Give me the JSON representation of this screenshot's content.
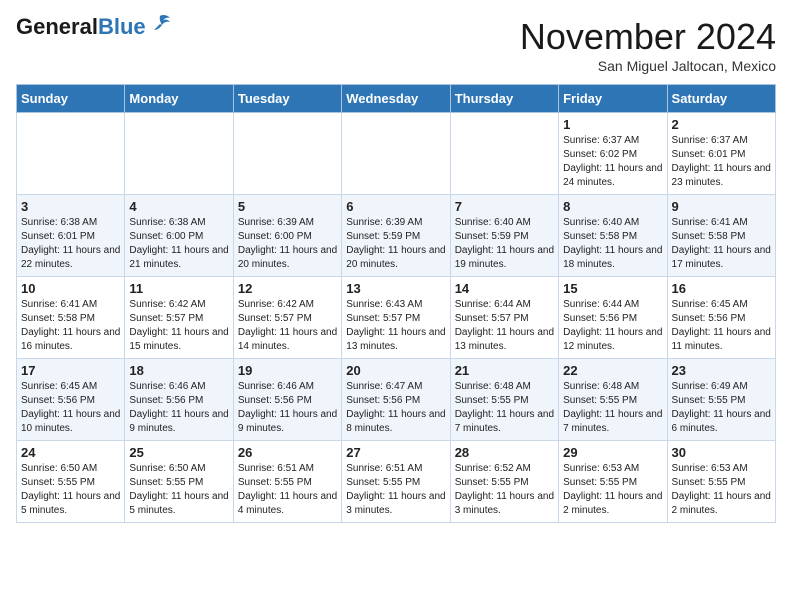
{
  "header": {
    "logo_general": "General",
    "logo_blue": "Blue",
    "month_title": "November 2024",
    "location": "San Miguel Jaltocan, Mexico"
  },
  "weekdays": [
    "Sunday",
    "Monday",
    "Tuesday",
    "Wednesday",
    "Thursday",
    "Friday",
    "Saturday"
  ],
  "weeks": [
    [
      {
        "day": "",
        "info": ""
      },
      {
        "day": "",
        "info": ""
      },
      {
        "day": "",
        "info": ""
      },
      {
        "day": "",
        "info": ""
      },
      {
        "day": "",
        "info": ""
      },
      {
        "day": "1",
        "info": "Sunrise: 6:37 AM\nSunset: 6:02 PM\nDaylight: 11 hours and 24 minutes."
      },
      {
        "day": "2",
        "info": "Sunrise: 6:37 AM\nSunset: 6:01 PM\nDaylight: 11 hours and 23 minutes."
      }
    ],
    [
      {
        "day": "3",
        "info": "Sunrise: 6:38 AM\nSunset: 6:01 PM\nDaylight: 11 hours and 22 minutes."
      },
      {
        "day": "4",
        "info": "Sunrise: 6:38 AM\nSunset: 6:00 PM\nDaylight: 11 hours and 21 minutes."
      },
      {
        "day": "5",
        "info": "Sunrise: 6:39 AM\nSunset: 6:00 PM\nDaylight: 11 hours and 20 minutes."
      },
      {
        "day": "6",
        "info": "Sunrise: 6:39 AM\nSunset: 5:59 PM\nDaylight: 11 hours and 20 minutes."
      },
      {
        "day": "7",
        "info": "Sunrise: 6:40 AM\nSunset: 5:59 PM\nDaylight: 11 hours and 19 minutes."
      },
      {
        "day": "8",
        "info": "Sunrise: 6:40 AM\nSunset: 5:58 PM\nDaylight: 11 hours and 18 minutes."
      },
      {
        "day": "9",
        "info": "Sunrise: 6:41 AM\nSunset: 5:58 PM\nDaylight: 11 hours and 17 minutes."
      }
    ],
    [
      {
        "day": "10",
        "info": "Sunrise: 6:41 AM\nSunset: 5:58 PM\nDaylight: 11 hours and 16 minutes."
      },
      {
        "day": "11",
        "info": "Sunrise: 6:42 AM\nSunset: 5:57 PM\nDaylight: 11 hours and 15 minutes."
      },
      {
        "day": "12",
        "info": "Sunrise: 6:42 AM\nSunset: 5:57 PM\nDaylight: 11 hours and 14 minutes."
      },
      {
        "day": "13",
        "info": "Sunrise: 6:43 AM\nSunset: 5:57 PM\nDaylight: 11 hours and 13 minutes."
      },
      {
        "day": "14",
        "info": "Sunrise: 6:44 AM\nSunset: 5:57 PM\nDaylight: 11 hours and 13 minutes."
      },
      {
        "day": "15",
        "info": "Sunrise: 6:44 AM\nSunset: 5:56 PM\nDaylight: 11 hours and 12 minutes."
      },
      {
        "day": "16",
        "info": "Sunrise: 6:45 AM\nSunset: 5:56 PM\nDaylight: 11 hours and 11 minutes."
      }
    ],
    [
      {
        "day": "17",
        "info": "Sunrise: 6:45 AM\nSunset: 5:56 PM\nDaylight: 11 hours and 10 minutes."
      },
      {
        "day": "18",
        "info": "Sunrise: 6:46 AM\nSunset: 5:56 PM\nDaylight: 11 hours and 9 minutes."
      },
      {
        "day": "19",
        "info": "Sunrise: 6:46 AM\nSunset: 5:56 PM\nDaylight: 11 hours and 9 minutes."
      },
      {
        "day": "20",
        "info": "Sunrise: 6:47 AM\nSunset: 5:56 PM\nDaylight: 11 hours and 8 minutes."
      },
      {
        "day": "21",
        "info": "Sunrise: 6:48 AM\nSunset: 5:55 PM\nDaylight: 11 hours and 7 minutes."
      },
      {
        "day": "22",
        "info": "Sunrise: 6:48 AM\nSunset: 5:55 PM\nDaylight: 11 hours and 7 minutes."
      },
      {
        "day": "23",
        "info": "Sunrise: 6:49 AM\nSunset: 5:55 PM\nDaylight: 11 hours and 6 minutes."
      }
    ],
    [
      {
        "day": "24",
        "info": "Sunrise: 6:50 AM\nSunset: 5:55 PM\nDaylight: 11 hours and 5 minutes."
      },
      {
        "day": "25",
        "info": "Sunrise: 6:50 AM\nSunset: 5:55 PM\nDaylight: 11 hours and 5 minutes."
      },
      {
        "day": "26",
        "info": "Sunrise: 6:51 AM\nSunset: 5:55 PM\nDaylight: 11 hours and 4 minutes."
      },
      {
        "day": "27",
        "info": "Sunrise: 6:51 AM\nSunset: 5:55 PM\nDaylight: 11 hours and 3 minutes."
      },
      {
        "day": "28",
        "info": "Sunrise: 6:52 AM\nSunset: 5:55 PM\nDaylight: 11 hours and 3 minutes."
      },
      {
        "day": "29",
        "info": "Sunrise: 6:53 AM\nSunset: 5:55 PM\nDaylight: 11 hours and 2 minutes."
      },
      {
        "day": "30",
        "info": "Sunrise: 6:53 AM\nSunset: 5:55 PM\nDaylight: 11 hours and 2 minutes."
      }
    ]
  ]
}
